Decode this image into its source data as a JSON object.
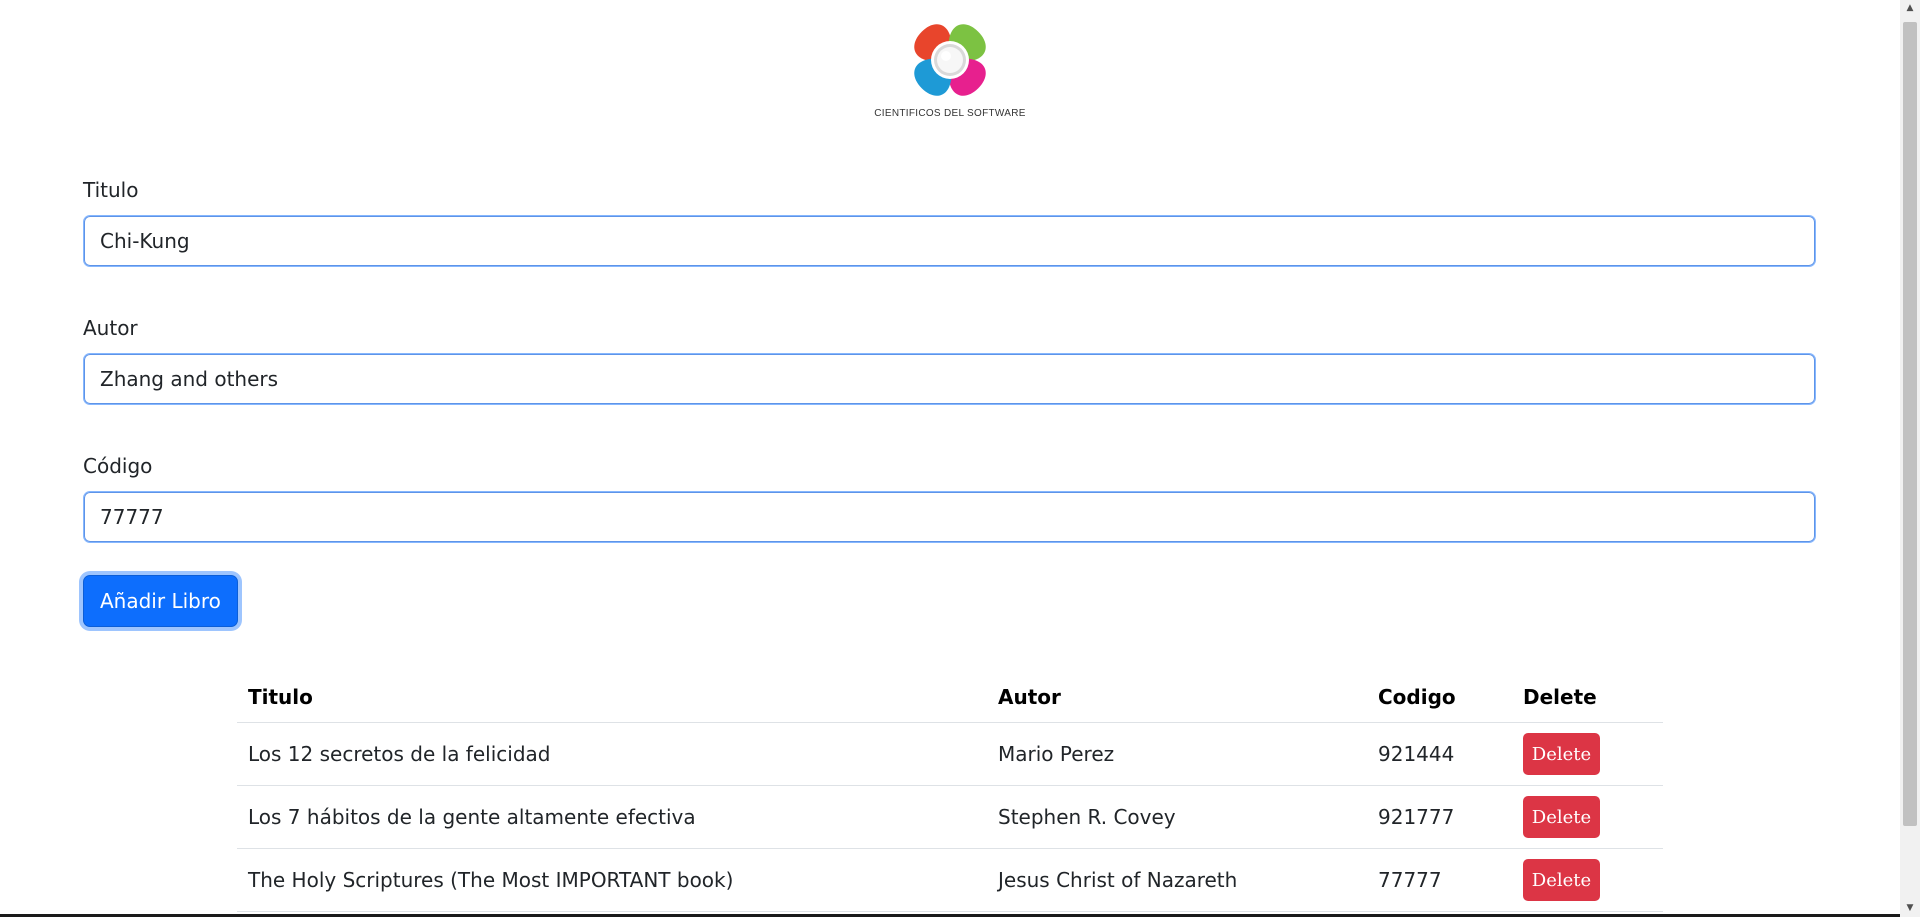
{
  "logo": {
    "caption": "CIENTIFICOS DEL SOFTWARE",
    "colors": [
      "#e8452c",
      "#7cc242",
      "#e7208e",
      "#1e9ad6",
      "#f5a623"
    ]
  },
  "form": {
    "titulo": {
      "label": "Titulo",
      "value": "Chi-Kung"
    },
    "autor": {
      "label": "Autor",
      "value": "Zhang and others"
    },
    "codigo": {
      "label": "Código",
      "value": "77777"
    },
    "submit_label": "Añadir Libro"
  },
  "table": {
    "headers": [
      "Titulo",
      "Autor",
      "Codigo",
      "Delete"
    ],
    "rows": [
      {
        "titulo": "Los 12 secretos de la felicidad",
        "autor": "Mario Perez",
        "codigo": "921444",
        "delete_label": "Delete"
      },
      {
        "titulo": "Los 7 hábitos de la gente altamente efectiva",
        "autor": "Stephen R. Covey",
        "codigo": "921777",
        "delete_label": "Delete"
      },
      {
        "titulo": "The Holy Scriptures (The Most IMPORTANT book)",
        "autor": "Jesus Christ of Nazareth",
        "codigo": "77777",
        "delete_label": "Delete"
      }
    ]
  },
  "colors": {
    "primary": "#0d6efd",
    "danger": "#dc3545"
  }
}
